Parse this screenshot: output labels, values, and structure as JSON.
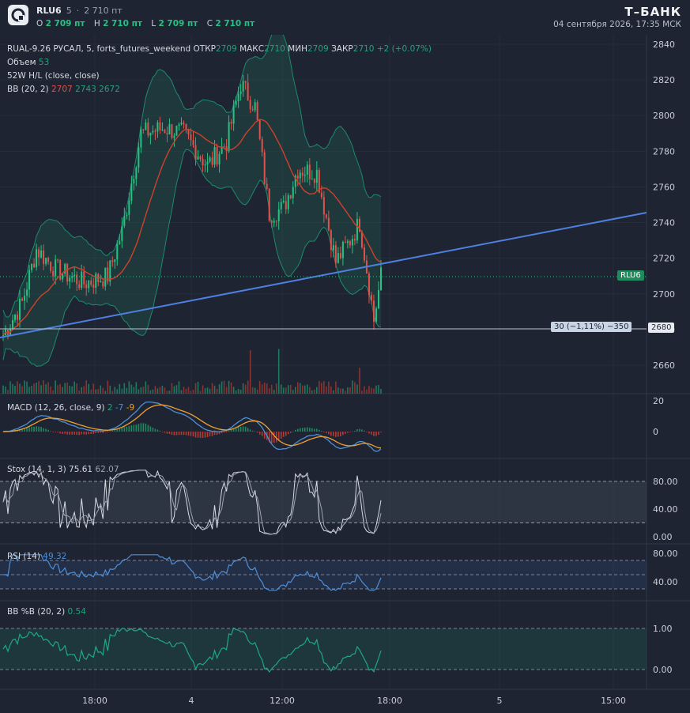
{
  "header": {
    "symbol": "RLU6",
    "interval": "5",
    "price": "2 710 пт",
    "ohlc": {
      "o": "2 709 пт",
      "h": "2 710 пт",
      "l": "2 709 пт",
      "c": "2 710 пт"
    },
    "brand": "Т–БАНК",
    "datetime": "04 сентября 2026, 17:35 МСК"
  },
  "legend": {
    "instrument": "RUAL-9.26 РУСАЛ, 5, forts_futures_weekend",
    "open_label": "ОТКР",
    "open": "2709",
    "high_label": "МАКС",
    "high": "2710",
    "low_label": "МИН",
    "low": "2709",
    "close_label": "ЗАКР",
    "close": "2710",
    "change": "+2 (+0.07%)",
    "volume_label": "Объем",
    "volume": "53",
    "hl_label": "52W H/L (close, close)",
    "bb_label": "BB (20, 2)",
    "bb_mid": "2707",
    "bb_up": "2743",
    "bb_low": "2672"
  },
  "macd": {
    "label": "MACD (12, 26, close, 9)",
    "v1": "2",
    "v2": "-7",
    "v3": "-9"
  },
  "stoch": {
    "label": "Stox (14, 1, 3)",
    "v1": "75.61",
    "v2": "62.07"
  },
  "rsi": {
    "label": "RSI (14)",
    "value": "49.32"
  },
  "bbpb": {
    "label": "BB %B (20, 2)",
    "value": "0.54"
  },
  "price_axis": [
    "2840",
    "2820",
    "2800",
    "2780",
    "2760",
    "2740",
    "2720",
    "2700",
    "2680",
    "2660"
  ],
  "macd_axis": [
    "20",
    "0"
  ],
  "stoch_axis": [
    "80.00",
    "40.00",
    "0.00"
  ],
  "rsi_axis": [
    "80.00",
    "40.00"
  ],
  "bbpb_axis": [
    "1.00",
    "0.00"
  ],
  "time_axis": [
    "18:00",
    "4",
    "12:00",
    "18:00",
    "5",
    "15:00"
  ],
  "tags": {
    "last": "RLU6",
    "measure": "30 (−1,11%)",
    "measure_ticks": "−350",
    "level": "2680"
  },
  "colors": {
    "bg": "#1e2431",
    "up": "#26c281",
    "down": "#e0524b",
    "trend": "#4f7fe0",
    "bb_mid": "#d0402c"
  }
}
